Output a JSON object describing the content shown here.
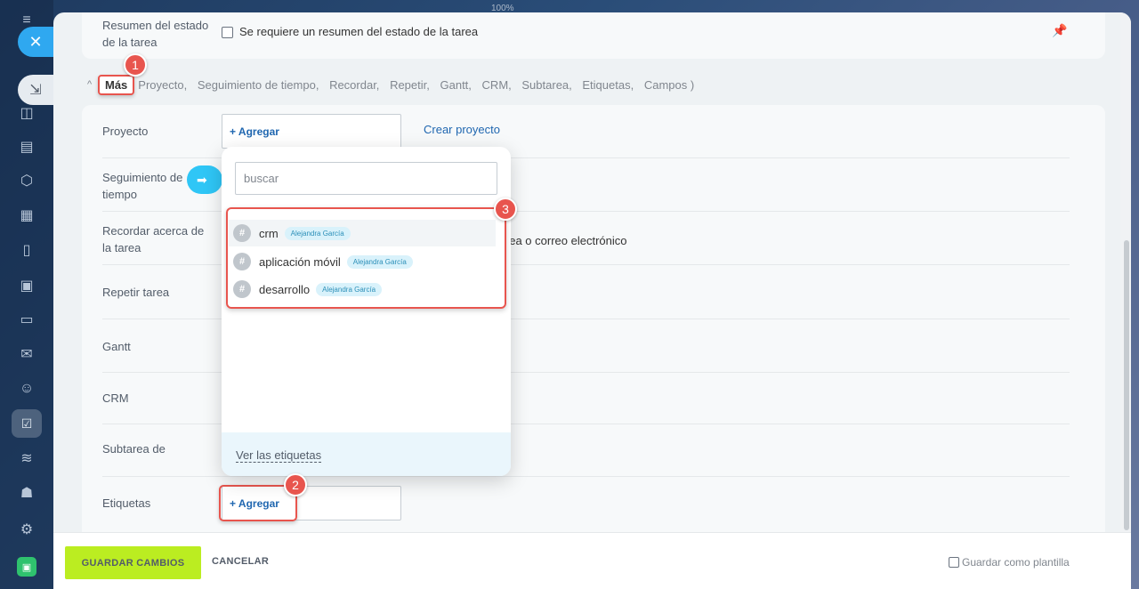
{
  "browser": {
    "zoom": "100%"
  },
  "summary": {
    "label": "Resumen del estado de la tarea",
    "checkbox_label": "Se requiere un resumen del estado de la tarea"
  },
  "more": {
    "label": "Más",
    "list": [
      "Proyecto,",
      "Seguimiento de tiempo,",
      "Recordar,",
      "Repetir,",
      "Gantt,",
      "CRM,",
      "Subtarea,",
      "Etiquetas,",
      "Campos )"
    ]
  },
  "fields": {
    "proyecto": {
      "label": "Proyecto",
      "add": "+ Agregar",
      "create": "Crear proyecto"
    },
    "seguimiento": {
      "label": "Seguimiento de tiempo"
    },
    "recordar": {
      "label": "Recordar acerca de la tarea",
      "peek": "nea o correo electrónico"
    },
    "repetir": {
      "label": "Repetir tarea"
    },
    "gantt": {
      "label": "Gantt"
    },
    "crm": {
      "label": "CRM"
    },
    "subtarea": {
      "label": "Subtarea de"
    },
    "etiquetas": {
      "label": "Etiquetas",
      "add": "+ Agregar"
    }
  },
  "dropdown": {
    "search_placeholder": "buscar",
    "tags": [
      {
        "name": "crm",
        "owner": "Alejandra García"
      },
      {
        "name": "aplicación móvil",
        "owner": "Alejandra García"
      },
      {
        "name": "desarrollo",
        "owner": "Alejandra García"
      }
    ],
    "footer_link": "Ver las etiquetas"
  },
  "badges": [
    "1",
    "2",
    "3"
  ],
  "footer": {
    "save": "GUARDAR CAMBIOS",
    "cancel": "CANCELAR",
    "template": "Guardar como plantilla"
  },
  "colors": {
    "accent_red": "#e8554e",
    "save_green": "#bbed21",
    "link_blue": "#2067b0",
    "pill_cyan": "#2fc6f6"
  }
}
